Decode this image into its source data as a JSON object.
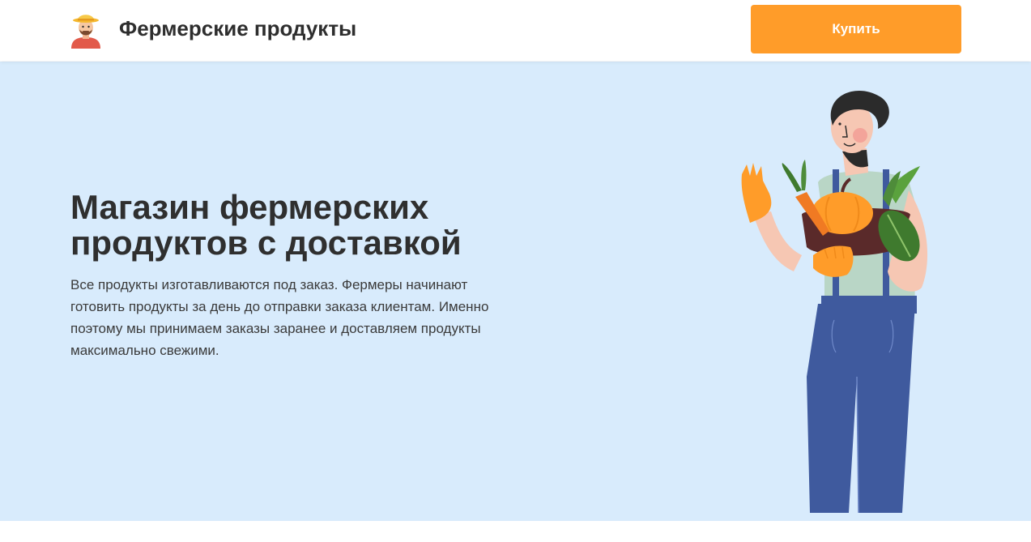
{
  "header": {
    "brand": "Фермерские продукты",
    "logo_icon": "farmer-avatar-icon",
    "buy_button": "Купить"
  },
  "hero": {
    "title": "Магазин фермерских продуктов с доставкой",
    "description": "Все продукты изготавливаются под заказ. Фермеры начинают готовить продукты за день до отправки заказа клиентам. Именно поэтому мы принимаем заказы заранее и доставляем продукты максимально свежими.",
    "illustration_icon": "farmer-with-vegetables-illustration"
  },
  "colors": {
    "accent": "#ff9c29",
    "hero_background": "#d8ebfc",
    "text": "#333333"
  }
}
